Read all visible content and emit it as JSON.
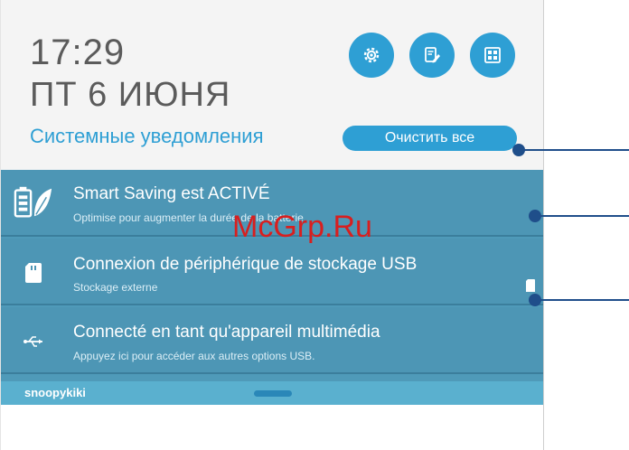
{
  "header": {
    "time": "17:29",
    "date": "ПТ 6 ИЮНЯ",
    "quick_settings": [
      {
        "icon": "gear-icon"
      },
      {
        "icon": "edit-note-icon"
      },
      {
        "icon": "grid-apps-icon"
      }
    ]
  },
  "system_notifications": {
    "label": "Системные уведомления",
    "clear_label": "Очистить все"
  },
  "notifications": [
    {
      "icon": "battery-leaf-icon",
      "title": "Smart Saving est ACTIVÉ",
      "subtitle": "Optimise pour augmenter la durée de la batterie"
    },
    {
      "icon": "sd-card-icon",
      "title": "Connexion de périphérique de stockage USB",
      "subtitle": "Stockage externe"
    },
    {
      "icon": "usb-icon",
      "title": "Connecté en tant qu'appareil multimédia",
      "subtitle": "Appuyez ici pour accéder aux autres options USB."
    }
  ],
  "footer": {
    "owner": "snoopykiki"
  },
  "watermark": "McGrp.Ru",
  "colors": {
    "accent": "#2e9fd4",
    "notification_bg": "#4d96b5",
    "callout": "#1f4e8a",
    "watermark": "#d81f1f"
  }
}
